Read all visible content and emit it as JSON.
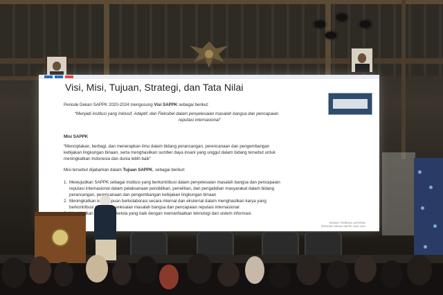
{
  "slide": {
    "title": "Visi, Misi, Tujuan, Strategi, dan Tata Nilai",
    "period_intro": "Periode Dekan SAPPK 2020-2024 mengusung",
    "visi_label": "Visi SAPPK",
    "period_tail": "sebagai berikut:",
    "visi_quote_1": "“Menjadi institusi yang Inklusif, Adaptif, dan Fleksibel dalam penyelesaian masalah bangsa dan pencapaian",
    "visi_quote_2": "reputasi internasional”",
    "misi_heading": "Misi SAPPK",
    "misi_1": "“Menciptakan, berbagi, dan menerapkan ilmu dalam bidang perancangan, perencanaan dan pengembangan",
    "misi_2": "kebijakan lingkungan binaan, serta menghasilkan sumber daya insani yang unggul dalam bidang tersebut untuk",
    "misi_3": "meningkatkan Indonesia dan dunia lebih baik”",
    "tujuan_intro": "Misi tersebut dijabarkan dalam",
    "tujuan_label": "Tujuan SAPPK",
    "tujuan_tail": ", sebagai berikut:",
    "item1_num": "1.",
    "item1_a": "Mewujudkan SAPPK sebagai institusi yang berkontribusi dalam penyelesaian masalah bangsa dan pencapaian",
    "item1_b": "reputasi internasional dalam pelaksanaan pendidikan, penelitian, dan pengabdian masyarakat dalam bidang",
    "item1_c": "perancangan, perencanaan dan pengembangan kebijakan lingkungan binaan",
    "item2_num": "2.",
    "item2_a": "Meningkatkan kemampuan berkolaborasi secara internal dan eksternal dalam menghasilkan karya yang",
    "item2_b": "berkontribusi dalam penyelesaian masalah bangsa dan pencapaian reputasi internasional",
    "item3_num": "3.",
    "item3_a": "Mewujudkan sistem tata kelola yang baik dengan memanfaatkan teknologi dan sistem informasi.",
    "footer_1": "SIDANG TERBUKA LAPORAN",
    "footer_2": "PERIODE DEKAN SAPPK 2020-2024"
  },
  "colors": {
    "screen": "#ffffff",
    "accent": "#2d6bb5",
    "podium": "#7b4a24",
    "banner": "#2a3c66"
  }
}
